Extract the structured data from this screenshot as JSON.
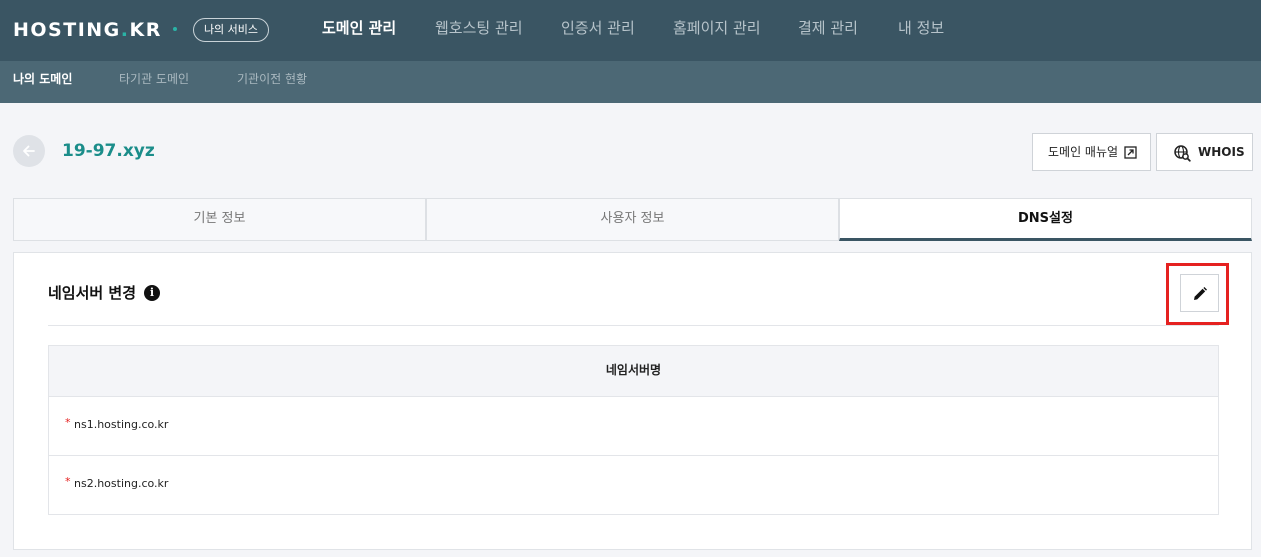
{
  "header": {
    "logo_main": "HOSTING",
    "logo_dot": ".",
    "logo_tld": "KR",
    "my_service_badge": "나의 서비스",
    "nav": [
      {
        "label": "도메인 관리"
      },
      {
        "label": "웹호스팅 관리"
      },
      {
        "label": "인증서 관리"
      },
      {
        "label": "홈페이지 관리"
      },
      {
        "label": "결제 관리"
      },
      {
        "label": "내 정보"
      }
    ],
    "active_nav": "도메인 관리"
  },
  "subnav": {
    "items": [
      {
        "label": "나의 도메인"
      },
      {
        "label": "타기관 도메인"
      },
      {
        "label": "기관이전 현황"
      }
    ],
    "active": "나의 도메인"
  },
  "page": {
    "domain": "19-97.xyz",
    "manual_button": "도메인 매뉴얼",
    "whois_button": "WHOIS"
  },
  "tabs": [
    {
      "label": "기본 정보"
    },
    {
      "label": "사용자 정보"
    },
    {
      "label": "DNS설정"
    }
  ],
  "active_tab": "DNS설정",
  "nameserver": {
    "title": "네임서버 변경",
    "info_glyph": "i",
    "column_header": "네임서버명",
    "required_mark": "*",
    "rows": [
      {
        "value": "ns1.hosting.co.kr"
      },
      {
        "value": "ns2.hosting.co.kr"
      }
    ]
  },
  "colors": {
    "topbar": "#3a5563",
    "subbar": "#4c6875",
    "accent_teal": "#1b8d8a",
    "highlight_red": "#e52120"
  },
  "icons": {
    "back": "arrow-left-icon",
    "manual": "external-link-icon",
    "whois": "globe-search-icon",
    "info": "info-icon",
    "edit": "pencil-icon"
  }
}
